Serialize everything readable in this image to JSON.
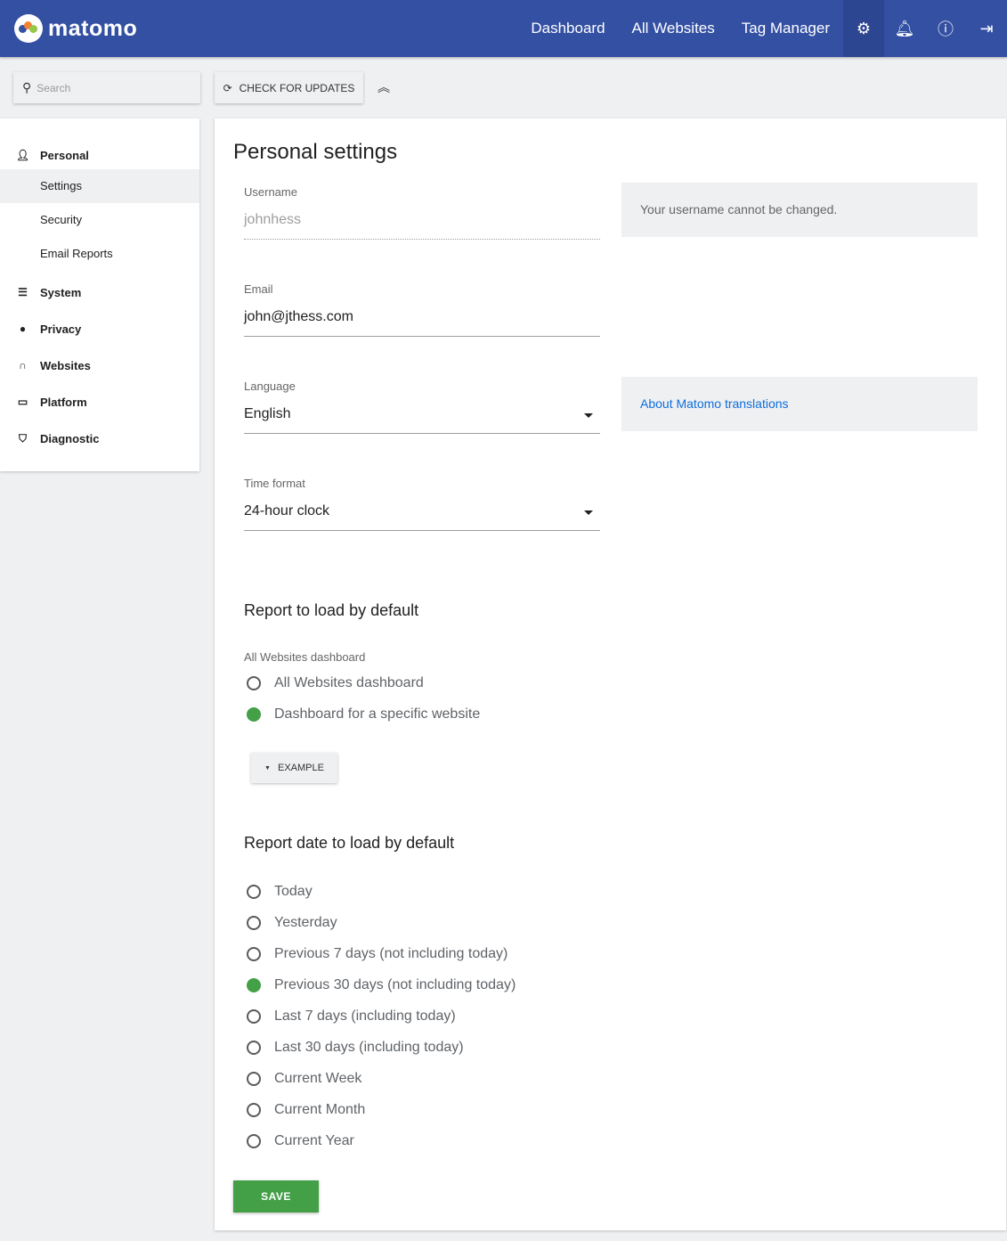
{
  "header": {
    "logo": "matomo",
    "nav": [
      "Dashboard",
      "All Websites",
      "Tag Manager"
    ],
    "icons": [
      "gear-icon",
      "bell-icon",
      "info-icon",
      "logout-icon"
    ],
    "color": "#3450a3"
  },
  "toolbar": {
    "search_placeholder": "Search",
    "check_updates": "CHECK FOR UPDATES"
  },
  "sidebar": {
    "personal": "Personal",
    "sub": [
      "Settings",
      "Security",
      "Email Reports"
    ],
    "sections": [
      "System",
      "Privacy",
      "Websites",
      "Platform",
      "Diagnostic"
    ]
  },
  "main": {
    "title": "Personal settings",
    "username": {
      "label": "Username",
      "value": "johnhess",
      "help": "Your username cannot be changed."
    },
    "email": {
      "label": "Email",
      "value": "john@jthess.com"
    },
    "language": {
      "label": "Language",
      "value": "English",
      "help": "About Matomo translations"
    },
    "time_format": {
      "label": "Time format",
      "value": "24-hour clock"
    },
    "report": {
      "heading": "Report to load by default",
      "label": "All Websites dashboard",
      "options": [
        "All Websites dashboard",
        "Dashboard for a specific website"
      ],
      "selected": 1,
      "example": "EXAMPLE"
    },
    "date": {
      "heading": "Report date to load by default",
      "options": [
        "Today",
        "Yesterday",
        "Previous 7 days (not including today)",
        "Previous 30 days (not including today)",
        "Last 7 days (including today)",
        "Last 30 days (including today)",
        "Current Week",
        "Current Month",
        "Current Year"
      ],
      "selected": 3
    },
    "save": "SAVE"
  }
}
